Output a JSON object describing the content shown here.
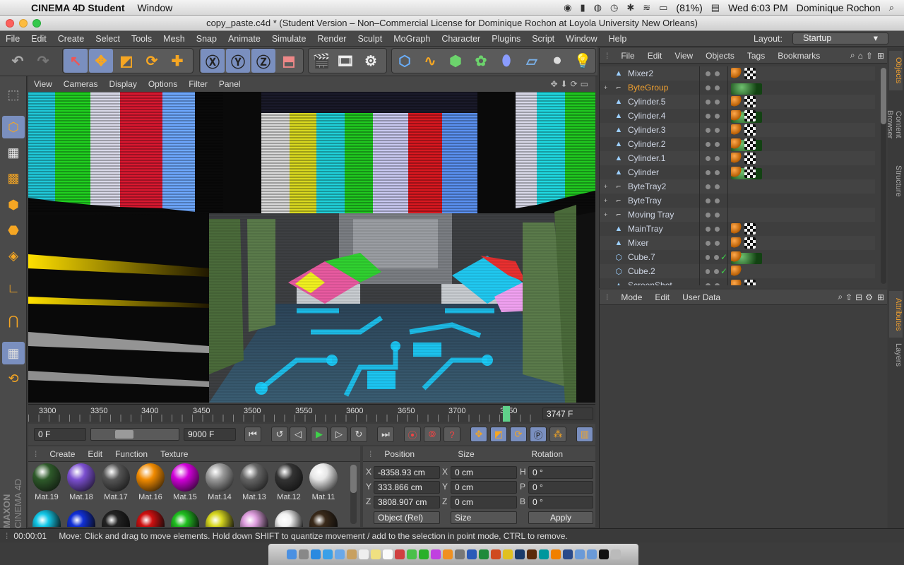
{
  "mac_menubar": {
    "app_name": "CINEMA 4D Student",
    "items": [
      "Window"
    ],
    "battery": "(81%)",
    "clock": "Wed 6:03 PM",
    "user": "Dominique Rochon"
  },
  "window": {
    "title": "copy_paste.c4d * (Student Version – Non–Commercial License for Dominique Rochon at Loyola University New Orleans)"
  },
  "app_menu": {
    "items": [
      "File",
      "Edit",
      "Create",
      "Select",
      "Tools",
      "Mesh",
      "Snap",
      "Animate",
      "Simulate",
      "Render",
      "Sculpt",
      "MoGraph",
      "Character",
      "Plugins",
      "Script",
      "Window",
      "Help"
    ],
    "layout_label": "Layout:",
    "layout_value": "Startup"
  },
  "viewport_menu": {
    "items": [
      "View",
      "Cameras",
      "Display",
      "Options",
      "Filter",
      "Panel"
    ]
  },
  "timeline": {
    "ticks": [
      "3300",
      "3350",
      "3400",
      "3450",
      "3500",
      "3550",
      "3600",
      "3650",
      "3700",
      "3750"
    ],
    "current_frame": "3747 F"
  },
  "playbar": {
    "start": "0 F",
    "end": "9000 F"
  },
  "material_manager": {
    "menu": [
      "Create",
      "Edit",
      "Function",
      "Texture"
    ],
    "materials": [
      "Mat.19",
      "Mat.18",
      "Mat.17",
      "Mat.16",
      "Mat.15",
      "Mat.14",
      "Mat.13",
      "Mat.12",
      "Mat.11"
    ],
    "colors": [
      "#2e5a2a",
      "#7b4fd0",
      "#555555",
      "#f08a00",
      "#d000d8",
      "#9a9a9a",
      "#666666",
      "#333333",
      "#e6e6e6"
    ],
    "row2_colors": [
      "#12c8e8",
      "#1030d8",
      "#222222",
      "#d01010",
      "#20c020",
      "#d8d820",
      "#e0a0e0",
      "#f2f2f2",
      "#3a2a1a"
    ]
  },
  "coordinates": {
    "headers": [
      "Position",
      "Size",
      "Rotation"
    ],
    "rows": [
      {
        "axis": "X",
        "pos": "-8358.93 cm",
        "size_axis": "X",
        "size": "0 cm",
        "rot_axis": "H",
        "rot": "0 °"
      },
      {
        "axis": "Y",
        "pos": "333.866 cm",
        "size_axis": "Y",
        "size": "0 cm",
        "rot_axis": "P",
        "rot": "0 °"
      },
      {
        "axis": "Z",
        "pos": "3808.907 cm",
        "size_axis": "Z",
        "size": "0 cm",
        "rot_axis": "B",
        "rot": "0 °"
      }
    ],
    "mode": "Object (Rel)",
    "size_mode": "Size",
    "apply": "Apply"
  },
  "object_manager": {
    "menu": [
      "File",
      "Edit",
      "View",
      "Objects",
      "Tags",
      "Bookmarks"
    ],
    "objects": [
      {
        "name": "Mixer2",
        "type": "cone",
        "expand": "",
        "tags": [
          "phong",
          "tex",
          "mat"
        ]
      },
      {
        "name": "ByteGroup",
        "type": "null",
        "expand": "+",
        "tags": []
      },
      {
        "name": "Cylinder.5",
        "type": "cone",
        "expand": "",
        "tags": [
          "phong",
          "tex",
          "mat"
        ]
      },
      {
        "name": "Cylinder.4",
        "type": "cone",
        "expand": "",
        "tags": [
          "phong",
          "tex",
          "mat"
        ]
      },
      {
        "name": "Cylinder.3",
        "type": "cone",
        "expand": "",
        "tags": [
          "phong",
          "tex",
          "mat"
        ]
      },
      {
        "name": "Cylinder.2",
        "type": "cone",
        "expand": "",
        "tags": [
          "phong",
          "tex",
          "mat"
        ]
      },
      {
        "name": "Cylinder.1",
        "type": "cone",
        "expand": "",
        "tags": [
          "phong",
          "tex",
          "mat"
        ]
      },
      {
        "name": "Cylinder",
        "type": "cone",
        "expand": "",
        "tags": [
          "phong",
          "tex",
          "mat"
        ]
      },
      {
        "name": "ByteTray2",
        "type": "null",
        "expand": "+",
        "tags": []
      },
      {
        "name": "ByteTray",
        "type": "null",
        "expand": "+",
        "tags": []
      },
      {
        "name": "Moving Tray",
        "type": "null",
        "expand": "+",
        "tags": []
      },
      {
        "name": "MainTray",
        "type": "cone",
        "expand": "",
        "tags": [
          "phong",
          "tex"
        ]
      },
      {
        "name": "Mixer",
        "type": "cone",
        "expand": "",
        "tags": [
          "phong",
          "tex",
          "mat"
        ]
      },
      {
        "name": "Cube.7",
        "type": "cube",
        "expand": "",
        "tags": [
          "phong"
        ]
      },
      {
        "name": "Cube.2",
        "type": "cube",
        "expand": "",
        "tags": [
          "phong"
        ]
      },
      {
        "name": "ScreenShot",
        "type": "cone",
        "expand": "",
        "tags": [
          "phong",
          "tex",
          "mat"
        ]
      }
    ],
    "highlight_color": "#f0a030"
  },
  "attribute_manager": {
    "menu": [
      "Mode",
      "Edit",
      "User Data"
    ]
  },
  "right_tabs": [
    "Objects",
    "Content Browser",
    "Structure",
    "Attributes",
    "Layers"
  ],
  "status": {
    "time": "00:00:01",
    "message": "Move: Click and drag to move elements. Hold down SHIFT to quantize movement / add to the selection in point mode, CTRL to remove."
  },
  "brand": {
    "line1": "MAXON",
    "line2": "CINEMA 4D"
  }
}
